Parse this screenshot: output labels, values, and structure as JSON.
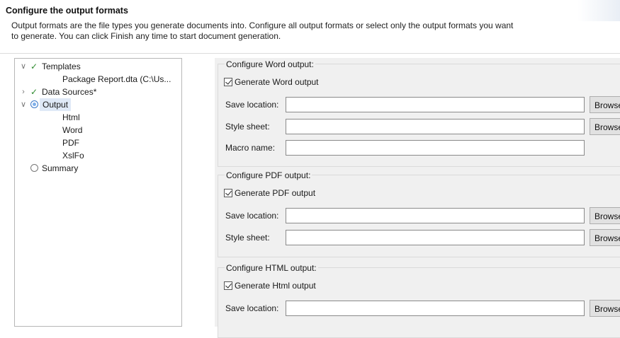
{
  "header": {
    "title": "Configure the output formats",
    "description_line1": "Output formats are the file types you generate documents into. Configure all output formats or select only the output formats you want",
    "description_line2": "to generate. You can click Finish any time to start document generation."
  },
  "tree": {
    "nodes": [
      {
        "label": "Templates",
        "status": "done",
        "expanded": true,
        "children": [
          "Package Report.dta (C:\\Us..."
        ]
      },
      {
        "label": "Data Sources*",
        "status": "done",
        "expanded": false,
        "children": []
      },
      {
        "label": "Output",
        "status": "current",
        "expanded": true,
        "selected": true,
        "children": [
          "Html",
          "Word",
          "PDF",
          "XslFo"
        ]
      },
      {
        "label": "Summary",
        "status": "pending",
        "expanded": false,
        "children": []
      }
    ]
  },
  "word": {
    "group_title": "Configure Word output:",
    "generate_label": "Generate Word output",
    "generate_checked": true,
    "save_location_label": "Save location:",
    "save_location_value": "",
    "style_sheet_label": "Style sheet:",
    "style_sheet_value": "",
    "macro_name_label": "Macro name:",
    "macro_name_value": "",
    "browse_label": "Browse"
  },
  "pdf": {
    "group_title": "Configure PDF output:",
    "generate_label": "Generate PDF output",
    "generate_checked": true,
    "save_location_label": "Save location:",
    "save_location_value": "",
    "style_sheet_label": "Style sheet:",
    "style_sheet_value": "",
    "browse_label": "Browse"
  },
  "html": {
    "group_title": "Configure HTML output:",
    "generate_label": "Generate Html output",
    "generate_checked": true,
    "save_location_label": "Save location:",
    "save_location_value": "",
    "browse_label": "Browse"
  },
  "colors": {
    "check_green": "#2e8b2e",
    "selection_bg": "#dfe9f7",
    "radio_blue": "#3a78c7",
    "panel_bg": "#f0f0f0"
  }
}
